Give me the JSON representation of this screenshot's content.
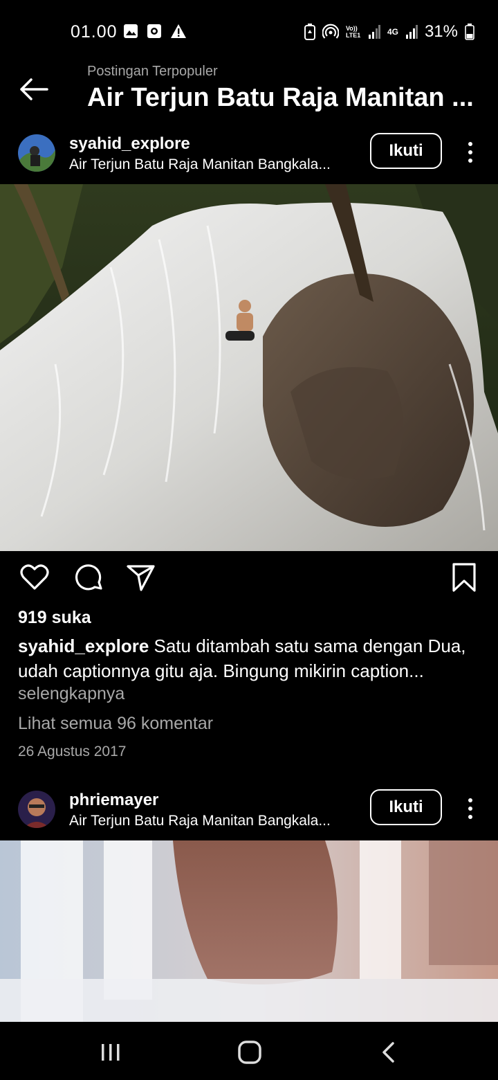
{
  "status_bar": {
    "time": "01.00",
    "battery": "31%",
    "icons_left": [
      "gallery-icon",
      "screen-record-icon",
      "warning-icon"
    ],
    "icons_right": [
      "battery-saver-icon",
      "hotspot-icon",
      "volte-icon",
      "signal-icon",
      "4g-icon",
      "signal-icon",
      "battery-icon"
    ],
    "network_label": "4G",
    "volte_label": "Vo)) LTE1"
  },
  "header": {
    "subtitle": "Postingan Terpopuler",
    "title": "Air Terjun Batu Raja Manitan ..."
  },
  "posts": [
    {
      "username": "syahid_explore",
      "location": "Air Terjun Batu Raja Manitan Bangkala...",
      "follow_label": "Ikuti",
      "likes": "919 suka",
      "caption_user": "syahid_explore",
      "caption_text": " Satu ditambah satu sama dengan Dua, udah captionnya gitu aja. Bingung mikirin caption...",
      "more_label": "selengkapnya",
      "comments_label": "Lihat semua 96 komentar",
      "date": "26 Agustus 2017"
    },
    {
      "username": "phriemayer",
      "location": "Air Terjun Batu Raja Manitan Bangkala...",
      "follow_label": "Ikuti"
    }
  ],
  "actions": [
    "heart-icon",
    "comment-icon",
    "share-icon",
    "bookmark-icon"
  ],
  "nav_bar": [
    "recent-apps-icon",
    "home-icon",
    "back-icon"
  ],
  "colors": {
    "background": "#000000",
    "secondary_text": "#a8a8a8"
  }
}
